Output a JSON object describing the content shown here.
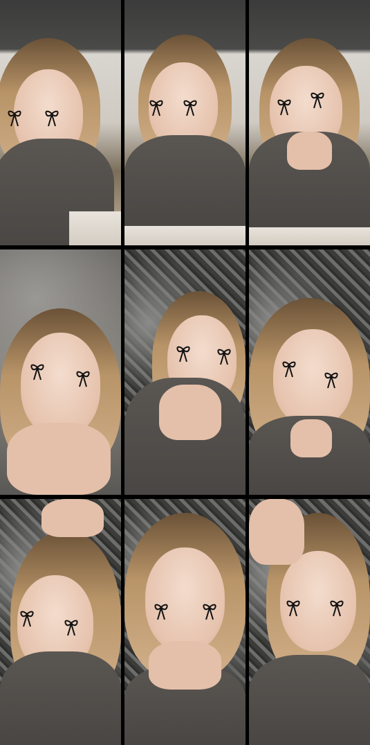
{
  "layout": {
    "rows": 3,
    "columns": 3
  },
  "tiles": [
    {
      "scene": "indoor-room-desk",
      "filter": "bow-ribbon-stickers"
    },
    {
      "scene": "indoor-room-desk",
      "filter": "bow-ribbon-stickers"
    },
    {
      "scene": "indoor-room-desk",
      "filter": "bow-ribbon-stickers"
    },
    {
      "scene": "textured-wall-blurry",
      "filter": "bow-ribbon-stickers"
    },
    {
      "scene": "textured-wall",
      "filter": "bow-ribbon-stickers"
    },
    {
      "scene": "textured-wall",
      "filter": "bow-ribbon-stickers"
    },
    {
      "scene": "textured-wall-hand-on-head",
      "filter": "bow-ribbon-stickers"
    },
    {
      "scene": "textured-wall",
      "filter": "bow-ribbon-stickers"
    },
    {
      "scene": "textured-wall-hand-on-head",
      "filter": "bow-ribbon-stickers"
    }
  ],
  "colors": {
    "gutter": "#000000",
    "hair": "#c49d72",
    "top": "#4d4946",
    "sticker": "#111111"
  }
}
